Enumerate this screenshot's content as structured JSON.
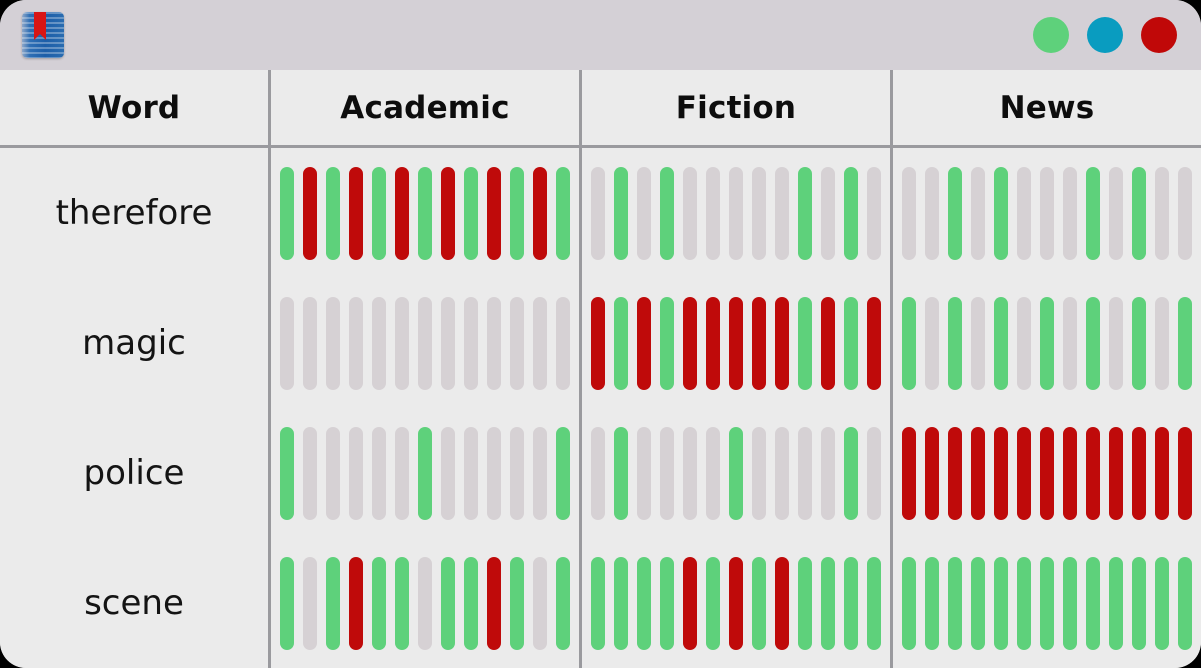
{
  "window": {
    "app_icon": "book-icon",
    "buttons": [
      {
        "name": "window-button-green",
        "color": "#5ed17b"
      },
      {
        "name": "window-button-blue",
        "color": "#099cc0"
      },
      {
        "name": "window-button-red",
        "color": "#c00808"
      }
    ]
  },
  "colors": {
    "green": "#5ed17b",
    "red": "#bf0a0a",
    "gray": "#d6d1d4",
    "titlebar": "#d4d0d6",
    "surface": "#ebebeb",
    "gridline": "#9a9a9e"
  },
  "table": {
    "headers": [
      "Word",
      "Academic",
      "Fiction",
      "News"
    ],
    "categories": [
      "Academic",
      "Fiction",
      "News"
    ]
  },
  "chart_data": {
    "type": "heatmap",
    "title": "",
    "xlabel": "",
    "ylabel": "",
    "legend": [
      "green",
      "red",
      "gray"
    ],
    "categories": [
      "Academic",
      "Fiction",
      "News"
    ],
    "rows": [
      {
        "word": "therefore",
        "cells": {
          "Academic": [
            "green",
            "red",
            "green",
            "red",
            "green",
            "red",
            "green",
            "red",
            "green",
            "red",
            "green",
            "red",
            "green"
          ],
          "Fiction": [
            "gray",
            "green",
            "gray",
            "green",
            "gray",
            "gray",
            "gray",
            "gray",
            "gray",
            "green",
            "gray",
            "green",
            "gray"
          ],
          "News": [
            "gray",
            "gray",
            "green",
            "gray",
            "green",
            "gray",
            "gray",
            "gray",
            "green",
            "gray",
            "green",
            "gray",
            "gray"
          ]
        }
      },
      {
        "word": "magic",
        "cells": {
          "Academic": [
            "gray",
            "gray",
            "gray",
            "gray",
            "gray",
            "gray",
            "gray",
            "gray",
            "gray",
            "gray",
            "gray",
            "gray",
            "gray"
          ],
          "Fiction": [
            "red",
            "green",
            "red",
            "green",
            "red",
            "red",
            "red",
            "red",
            "red",
            "green",
            "red",
            "green",
            "red"
          ],
          "News": [
            "green",
            "gray",
            "green",
            "gray",
            "green",
            "gray",
            "green",
            "gray",
            "green",
            "gray",
            "green",
            "gray",
            "green"
          ]
        }
      },
      {
        "word": "police",
        "cells": {
          "Academic": [
            "green",
            "gray",
            "gray",
            "gray",
            "gray",
            "gray",
            "green",
            "gray",
            "gray",
            "gray",
            "gray",
            "gray",
            "green"
          ],
          "Fiction": [
            "gray",
            "green",
            "gray",
            "gray",
            "gray",
            "gray",
            "green",
            "gray",
            "gray",
            "gray",
            "gray",
            "green",
            "gray"
          ],
          "News": [
            "red",
            "red",
            "red",
            "red",
            "red",
            "red",
            "red",
            "red",
            "red",
            "red",
            "red",
            "red",
            "red"
          ]
        }
      },
      {
        "word": "scene",
        "cells": {
          "Academic": [
            "green",
            "gray",
            "green",
            "red",
            "green",
            "green",
            "gray",
            "green",
            "green",
            "red",
            "green",
            "gray",
            "green"
          ],
          "Fiction": [
            "green",
            "green",
            "green",
            "green",
            "red",
            "green",
            "red",
            "green",
            "red",
            "green",
            "green",
            "green",
            "green"
          ],
          "News": [
            "green",
            "green",
            "green",
            "green",
            "green",
            "green",
            "green",
            "green",
            "green",
            "green",
            "green",
            "green",
            "green"
          ]
        }
      }
    ]
  }
}
